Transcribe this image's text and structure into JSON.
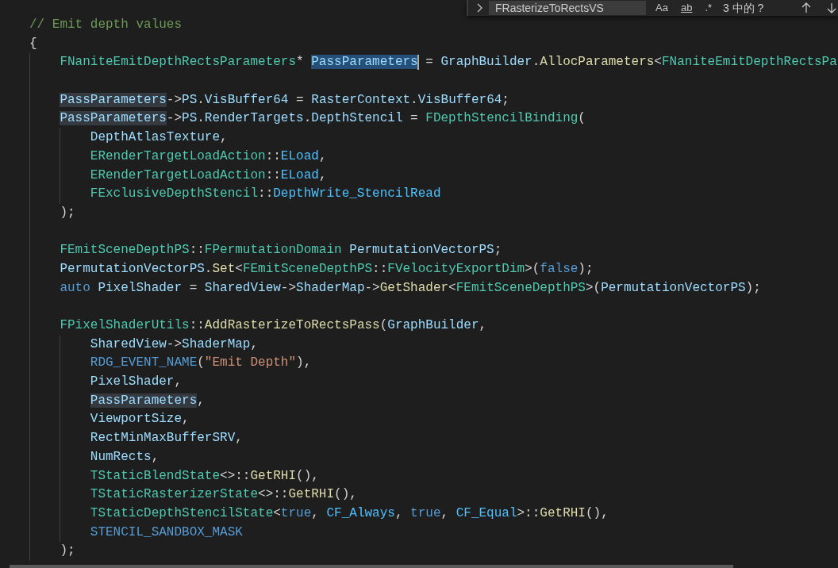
{
  "find_widget": {
    "query": "FRasterizeToRectsVS",
    "toggles": [
      {
        "text": "Aa",
        "kind": "plain",
        "on": false
      },
      {
        "text": "ab",
        "kind": "underlined",
        "on": false
      },
      {
        "text": ".*",
        "kind": "plain",
        "on": false
      }
    ],
    "result": "3 中的 ?"
  },
  "lines": [
    {
      "kind": "code",
      "tokens": [
        {
          "kind": "comment",
          "text": "// Emit depth values"
        }
      ]
    },
    {
      "kind": "code",
      "tokens": [
        {
          "kind": "plain",
          "text": "{"
        }
      ]
    },
    {
      "kind": "code",
      "tokens": [
        {
          "kind": "type",
          "text": "    FNaniteEmitDepthRectsParameters"
        },
        {
          "kind": "plain",
          "text": "* "
        },
        {
          "kind": "var",
          "text": "PassParameters",
          "selection": true,
          "cursor": true
        },
        {
          "kind": "plain",
          "text": " = "
        },
        {
          "kind": "var",
          "text": "GraphBuilder"
        },
        {
          "kind": "plain",
          "text": "."
        },
        {
          "kind": "func",
          "text": "AllocParameters"
        },
        {
          "kind": "plain",
          "text": "<"
        },
        {
          "kind": "type",
          "text": "FNaniteEmitDepthRectsPa"
        }
      ]
    },
    {
      "kind": "blank"
    },
    {
      "kind": "code",
      "tokens": [
        {
          "kind": "var",
          "text": "    PassParameters",
          "match_highlight": true
        },
        {
          "kind": "plain",
          "text": "->"
        },
        {
          "kind": "var",
          "text": "PS"
        },
        {
          "kind": "plain",
          "text": "."
        },
        {
          "kind": "var",
          "text": "VisBuffer64"
        },
        {
          "kind": "plain",
          "text": " = "
        },
        {
          "kind": "var",
          "text": "RasterContext"
        },
        {
          "kind": "plain",
          "text": "."
        },
        {
          "kind": "var",
          "text": "VisBuffer64"
        },
        {
          "kind": "plain",
          "text": ";"
        }
      ]
    },
    {
      "kind": "code",
      "tokens": [
        {
          "kind": "var",
          "text": "    PassParameters",
          "match_highlight": true
        },
        {
          "kind": "plain",
          "text": "->"
        },
        {
          "kind": "var",
          "text": "PS"
        },
        {
          "kind": "plain",
          "text": "."
        },
        {
          "kind": "var",
          "text": "RenderTargets"
        },
        {
          "kind": "plain",
          "text": "."
        },
        {
          "kind": "var",
          "text": "DepthStencil"
        },
        {
          "kind": "plain",
          "text": " = "
        },
        {
          "kind": "type",
          "text": "FDepthStencilBinding"
        },
        {
          "kind": "plain",
          "text": "("
        }
      ]
    },
    {
      "kind": "code",
      "tokens": [
        {
          "kind": "var",
          "text": "        DepthAtlasTexture"
        },
        {
          "kind": "plain",
          "text": ","
        }
      ]
    },
    {
      "kind": "code",
      "tokens": [
        {
          "kind": "type",
          "text": "        ERenderTargetLoadAction"
        },
        {
          "kind": "plain",
          "text": "::"
        },
        {
          "kind": "enum",
          "text": "ELoad"
        },
        {
          "kind": "plain",
          "text": ","
        }
      ]
    },
    {
      "kind": "code",
      "tokens": [
        {
          "kind": "type",
          "text": "        ERenderTargetLoadAction"
        },
        {
          "kind": "plain",
          "text": "::"
        },
        {
          "kind": "enum",
          "text": "ELoad"
        },
        {
          "kind": "plain",
          "text": ","
        }
      ]
    },
    {
      "kind": "code",
      "tokens": [
        {
          "kind": "type",
          "text": "        FExclusiveDepthStencil"
        },
        {
          "kind": "plain",
          "text": "::"
        },
        {
          "kind": "enum",
          "text": "DepthWrite_StencilRead"
        }
      ]
    },
    {
      "kind": "code",
      "tokens": [
        {
          "kind": "plain",
          "text": "    );"
        }
      ]
    },
    {
      "kind": "blank"
    },
    {
      "kind": "code",
      "tokens": [
        {
          "kind": "type",
          "text": "    FEmitSceneDepthPS"
        },
        {
          "kind": "plain",
          "text": "::"
        },
        {
          "kind": "type",
          "text": "FPermutationDomain"
        },
        {
          "kind": "var",
          "text": " PermutationVectorPS"
        },
        {
          "kind": "plain",
          "text": ";"
        }
      ]
    },
    {
      "kind": "code",
      "tokens": [
        {
          "kind": "var",
          "text": "    PermutationVectorPS"
        },
        {
          "kind": "plain",
          "text": "."
        },
        {
          "kind": "func",
          "text": "Set"
        },
        {
          "kind": "plain",
          "text": "<"
        },
        {
          "kind": "type",
          "text": "FEmitSceneDepthPS"
        },
        {
          "kind": "plain",
          "text": "::"
        },
        {
          "kind": "type",
          "text": "FVelocityExportDim"
        },
        {
          "kind": "plain",
          "text": ">("
        },
        {
          "kind": "keyword",
          "text": "false"
        },
        {
          "kind": "plain",
          "text": ");"
        }
      ]
    },
    {
      "kind": "code",
      "tokens": [
        {
          "kind": "keyword",
          "text": "    auto"
        },
        {
          "kind": "var",
          "text": " PixelShader"
        },
        {
          "kind": "plain",
          "text": " = "
        },
        {
          "kind": "var",
          "text": "SharedView"
        },
        {
          "kind": "plain",
          "text": "->"
        },
        {
          "kind": "var",
          "text": "ShaderMap"
        },
        {
          "kind": "plain",
          "text": "->"
        },
        {
          "kind": "func",
          "text": "GetShader"
        },
        {
          "kind": "plain",
          "text": "<"
        },
        {
          "kind": "type",
          "text": "FEmitSceneDepthPS"
        },
        {
          "kind": "plain",
          "text": ">("
        },
        {
          "kind": "var",
          "text": "PermutationVectorPS"
        },
        {
          "kind": "plain",
          "text": ");"
        }
      ]
    },
    {
      "kind": "blank"
    },
    {
      "kind": "code",
      "tokens": [
        {
          "kind": "type",
          "text": "    FPixelShaderUtils"
        },
        {
          "kind": "plain",
          "text": "::"
        },
        {
          "kind": "func",
          "text": "AddRasterizeToRectsPass"
        },
        {
          "kind": "plain",
          "text": "("
        },
        {
          "kind": "var",
          "text": "GraphBuilder"
        },
        {
          "kind": "plain",
          "text": ","
        }
      ]
    },
    {
      "kind": "code",
      "tokens": [
        {
          "kind": "var",
          "text": "        SharedView"
        },
        {
          "kind": "plain",
          "text": "->"
        },
        {
          "kind": "var",
          "text": "ShaderMap"
        },
        {
          "kind": "plain",
          "text": ","
        }
      ]
    },
    {
      "kind": "code",
      "tokens": [
        {
          "kind": "macro",
          "text": "        RDG_EVENT_NAME"
        },
        {
          "kind": "plain",
          "text": "("
        },
        {
          "kind": "string",
          "text": "\"Emit Depth\""
        },
        {
          "kind": "plain",
          "text": "),"
        }
      ]
    },
    {
      "kind": "code",
      "tokens": [
        {
          "kind": "var",
          "text": "        PixelShader"
        },
        {
          "kind": "plain",
          "text": ","
        }
      ]
    },
    {
      "kind": "code",
      "tokens": [
        {
          "kind": "var",
          "text": "        PassParameters",
          "match_highlight": true
        },
        {
          "kind": "plain",
          "text": ","
        }
      ]
    },
    {
      "kind": "code",
      "tokens": [
        {
          "kind": "var",
          "text": "        ViewportSize"
        },
        {
          "kind": "plain",
          "text": ","
        }
      ]
    },
    {
      "kind": "code",
      "tokens": [
        {
          "kind": "var",
          "text": "        RectMinMaxBufferSRV"
        },
        {
          "kind": "plain",
          "text": ","
        }
      ]
    },
    {
      "kind": "code",
      "tokens": [
        {
          "kind": "var",
          "text": "        NumRects"
        },
        {
          "kind": "plain",
          "text": ","
        }
      ]
    },
    {
      "kind": "code",
      "tokens": [
        {
          "kind": "type",
          "text": "        TStaticBlendState"
        },
        {
          "kind": "plain",
          "text": "<>::"
        },
        {
          "kind": "func",
          "text": "GetRHI"
        },
        {
          "kind": "plain",
          "text": "(),"
        }
      ]
    },
    {
      "kind": "code",
      "tokens": [
        {
          "kind": "type",
          "text": "        TStaticRasterizerState"
        },
        {
          "kind": "plain",
          "text": "<>::"
        },
        {
          "kind": "func",
          "text": "GetRHI"
        },
        {
          "kind": "plain",
          "text": "(),"
        }
      ]
    },
    {
      "kind": "code",
      "tokens": [
        {
          "kind": "type",
          "text": "        TStaticDepthStencilState"
        },
        {
          "kind": "plain",
          "text": "<"
        },
        {
          "kind": "keyword",
          "text": "true"
        },
        {
          "kind": "plain",
          "text": ", "
        },
        {
          "kind": "enum",
          "text": "CF_Always"
        },
        {
          "kind": "plain",
          "text": ", "
        },
        {
          "kind": "keyword",
          "text": "true"
        },
        {
          "kind": "plain",
          "text": ", "
        },
        {
          "kind": "enum",
          "text": "CF_Equal"
        },
        {
          "kind": "plain",
          "text": ">::"
        },
        {
          "kind": "func",
          "text": "GetRHI"
        },
        {
          "kind": "plain",
          "text": "(),"
        }
      ]
    },
    {
      "kind": "code",
      "tokens": [
        {
          "kind": "macro",
          "text": "        STENCIL_SANDBOX_MASK"
        }
      ]
    },
    {
      "kind": "code",
      "tokens": [
        {
          "kind": "plain",
          "text": "    );"
        }
      ]
    }
  ]
}
